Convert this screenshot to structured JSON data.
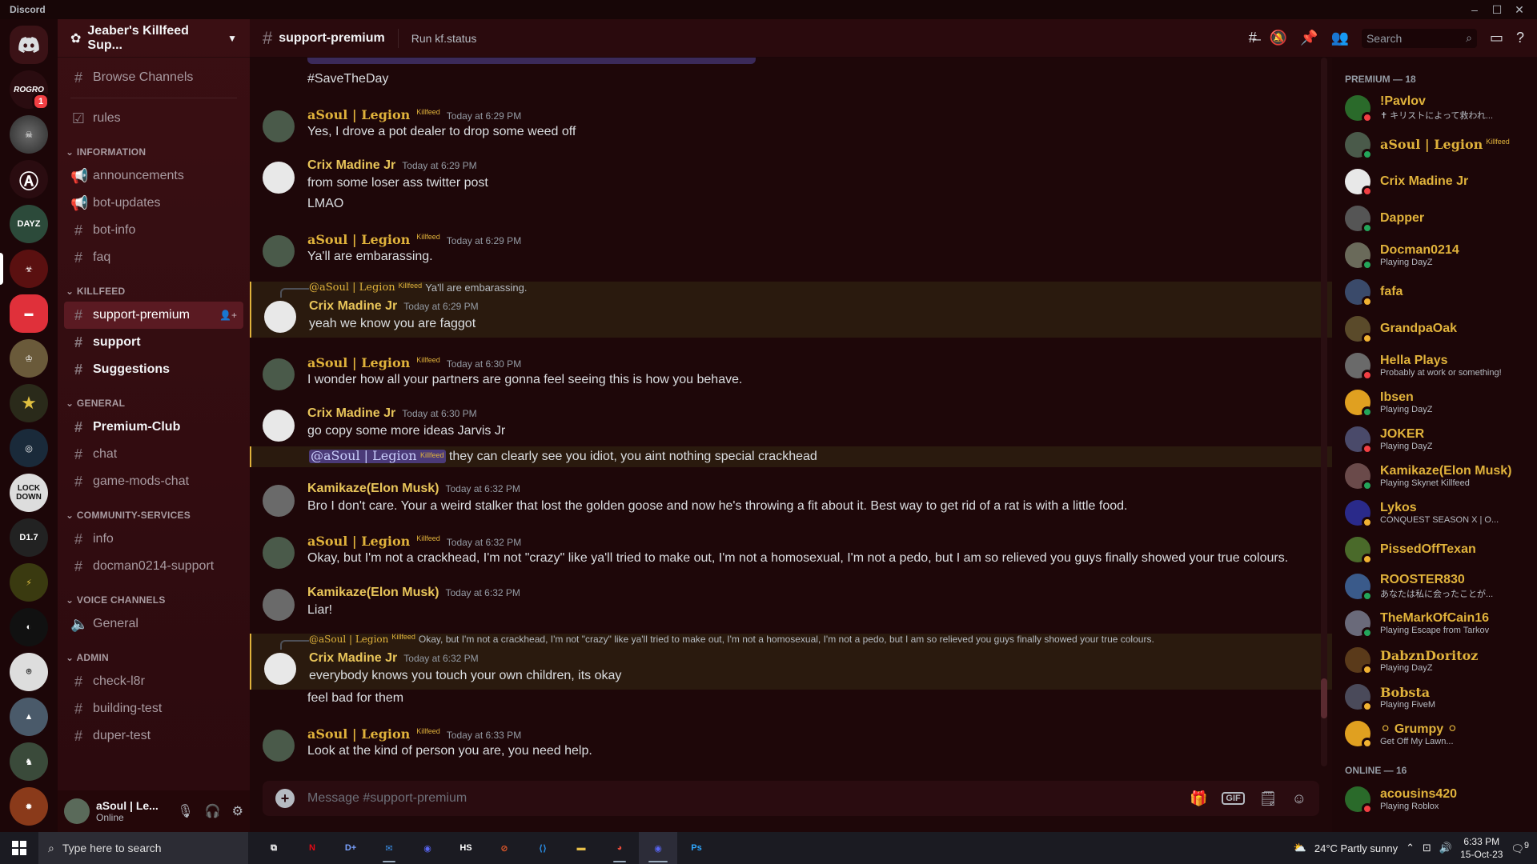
{
  "window": {
    "title": "Discord"
  },
  "guild": {
    "name": "Jeaber's Killfeed Sup..."
  },
  "sidebar": {
    "browse": "Browse Channels",
    "top": [
      {
        "label": "rules"
      }
    ],
    "categories": [
      {
        "name": "INFORMATION",
        "channels": [
          {
            "label": "announcements"
          },
          {
            "label": "bot-updates"
          },
          {
            "label": "bot-info"
          },
          {
            "label": "faq"
          }
        ]
      },
      {
        "name": "KILLFEED",
        "channels": [
          {
            "label": "support-premium"
          },
          {
            "label": "support"
          },
          {
            "label": "Suggestions"
          }
        ]
      },
      {
        "name": "GENERAL",
        "channels": [
          {
            "label": "Premium-Club"
          },
          {
            "label": "chat"
          },
          {
            "label": "game-mods-chat"
          }
        ]
      },
      {
        "name": "COMMUNITY-SERVICES",
        "channels": [
          {
            "label": "info"
          },
          {
            "label": "docman0214-support"
          }
        ]
      },
      {
        "name": "VOICE CHANNELS",
        "channels": [
          {
            "label": "General"
          }
        ]
      },
      {
        "name": "ADMIN",
        "channels": [
          {
            "label": "check-l8r"
          },
          {
            "label": "building-test"
          },
          {
            "label": "duper-test"
          }
        ]
      }
    ]
  },
  "user": {
    "name": "aSoul | Le...",
    "status": "Online"
  },
  "rail": {
    "badge": "1",
    "servers": [
      "ROGRO",
      "LOCK DOWN",
      "D1.7"
    ]
  },
  "header": {
    "channel": "support-premium",
    "topic": "Run kf.status",
    "search_placeholder": "Search"
  },
  "messages": {
    "top_line": "#SaveTheDay",
    "tag": "Killfeed",
    "m1": {
      "author": "aSoul | Legion",
      "time": "Today at 6:29 PM",
      "lines": [
        "Yes, I drove a pot dealer to drop some weed off"
      ]
    },
    "m2": {
      "author": "Crix Madine Jr",
      "time": "Today at 6:29 PM",
      "lines": [
        "from some loser ass twitter post",
        "LMAO"
      ]
    },
    "m3": {
      "author": "aSoul | Legion",
      "time": "Today at 6:29 PM",
      "lines": [
        "Ya'll are embarassing."
      ]
    },
    "m4": {
      "reply_author": "@aSoul | Legion",
      "reply_text": "Ya'll are embarassing.",
      "author": "Crix Madine Jr",
      "time": "Today at 6:29 PM",
      "lines": [
        "yeah we know you are faggot"
      ]
    },
    "m5": {
      "author": "aSoul | Legion",
      "time": "Today at 6:30 PM",
      "lines": [
        "I wonder how all your partners are gonna feel seeing this is how you behave."
      ]
    },
    "m6": {
      "author": "Crix Madine Jr",
      "time": "Today at 6:30 PM",
      "lines": [
        "go copy some more ideas Jarvis Jr"
      ],
      "mention": "@aSoul | Legion",
      "mention_rest": "they can clearly see you idiot, you aint nothing special crackhead"
    },
    "m7": {
      "author": "Kamikaze(Elon Musk)",
      "time": "Today at 6:32 PM",
      "lines": [
        "Bro I don't care. Your a weird stalker that lost the golden goose and now he's throwing a fit about it. Best way to get rid of a rat is with a little food."
      ]
    },
    "m8": {
      "author": "aSoul | Legion",
      "time": "Today at 6:32 PM",
      "lines": [
        "Okay, but I'm not a crackhead, I'm not \"crazy\" like ya'll tried to make out, I'm not a homosexual, I'm not a pedo, but I am so relieved you guys finally showed your true colours."
      ]
    },
    "m9": {
      "author": "Kamikaze(Elon Musk)",
      "time": "Today at 6:32 PM",
      "lines": [
        "Liar!"
      ]
    },
    "m10": {
      "reply_author": "@aSoul | Legion",
      "reply_text": "Okay, but I'm not a crackhead, I'm not \"crazy\" like ya'll tried to make out, I'm not a homosexual, I'm not a pedo, but I am so relieved you guys finally showed your true colours.",
      "author": "Crix Madine Jr",
      "time": "Today at 6:32 PM",
      "lines": [
        "everybody knows you touch your own children, its okay",
        "feel bad for them"
      ]
    },
    "m11": {
      "author": "aSoul | Legion",
      "time": "Today at 6:33 PM",
      "lines": [
        "Look at the kind of person you are, you need help."
      ]
    }
  },
  "composer": {
    "placeholder": "Message #support-premium",
    "gif": "GIF"
  },
  "members": {
    "premium_header": "PREMIUM — 18",
    "online_header": "ONLINE — 16",
    "tag": "Killfeed",
    "premium": [
      {
        "name": "!Pavlov",
        "activity": "✝ キリストによって救われ..."
      },
      {
        "name": "aSoul | Legion",
        "activity": ""
      },
      {
        "name": "Crix Madine Jr",
        "activity": ""
      },
      {
        "name": "Dapper",
        "activity": ""
      },
      {
        "name": "Docman0214",
        "activity": "Playing DayZ"
      },
      {
        "name": "fafa",
        "activity": ""
      },
      {
        "name": "GrandpaOak",
        "activity": ""
      },
      {
        "name": "Hella Plays",
        "activity": "Probably at work or something!"
      },
      {
        "name": "Ibsen",
        "activity": "Playing DayZ"
      },
      {
        "name": "JOKER",
        "activity": "Playing DayZ"
      },
      {
        "name": "Kamikaze(Elon Musk)",
        "activity": "Playing Skynet Killfeed"
      },
      {
        "name": "Lykos",
        "activity": "CONQUEST SEASON X | O..."
      },
      {
        "name": "PissedOffTexan",
        "activity": ""
      },
      {
        "name": "ROOSTER830",
        "activity": "あなたは私に会ったことが..."
      },
      {
        "name": "TheMarkOfCain16",
        "activity": "Playing Escape from Tarkov"
      },
      {
        "name": "DabznDoritoz",
        "activity": "Playing DayZ"
      },
      {
        "name": "Bobsta",
        "activity": "Playing FiveM"
      },
      {
        "name": "⚪ Grumpy ⚪",
        "activity": "Get Off My Lawn..."
      }
    ],
    "online": [
      {
        "name": "acousins420",
        "activity": "Playing Roblox"
      }
    ]
  },
  "taskbar": {
    "search": "Type here to search",
    "weather": "24°C  Partly sunny",
    "time": "6:33 PM",
    "date": "15-Oct-23",
    "notif": "9",
    "apps": [
      "N",
      "D+",
      "HS",
      "Ps"
    ]
  }
}
